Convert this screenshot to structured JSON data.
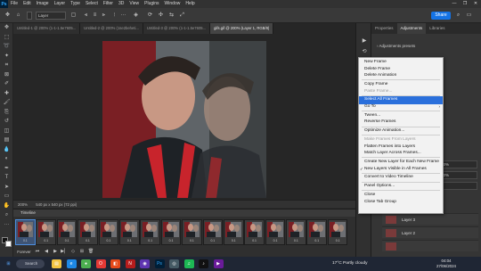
{
  "app": {
    "logo": "Ps"
  },
  "menu": [
    "File",
    "Edit",
    "Image",
    "Layer",
    "Type",
    "Select",
    "Filter",
    "3D",
    "View",
    "Plugins",
    "Window",
    "Help"
  ],
  "window_controls": [
    "—",
    "❐",
    "✕"
  ],
  "options_bar": {
    "layer_select": "Layer",
    "share_label": "Share",
    "icons": [
      "move-tool-icon",
      "auto-select-icon",
      "align-left-icon",
      "align-center-icon",
      "align-right-icon",
      "distribute-icon",
      "more-icon",
      "3d-mode-icon"
    ]
  },
  "tools": [
    "move-tool-icon",
    "marquee-tool-icon",
    "lasso-tool-icon",
    "magic-wand-icon",
    "crop-tool-icon",
    "frame-tool-icon",
    "eyedropper-icon",
    "healing-brush-icon",
    "brush-tool-icon",
    "clone-stamp-icon",
    "history-brush-icon",
    "eraser-icon",
    "gradient-icon",
    "blur-icon",
    "dodge-icon",
    "pen-tool-icon",
    "type-tool-icon",
    "path-select-icon",
    "rectangle-tool-icon",
    "hand-tool-icon",
    "zoom-tool-icon",
    "more-tools-icon"
  ],
  "tabs": [
    {
      "label": "Untitled-1 @ 200% (1-1-1.5e7605...",
      "active": false
    },
    {
      "label": "Untitled-2 @ 200% (1se2beheti...",
      "active": false
    },
    {
      "label": "Untitled-3 @ 200% (1-1-1.5e7605...",
      "active": false
    },
    {
      "label": "gifs.gif @ 200% (Layer 1, RGB/8)",
      "active": true
    }
  ],
  "status": {
    "zoom": "200%",
    "doc_info": "540 px x 540 px (72 ppi)"
  },
  "timeline": {
    "title": "Timeline",
    "frame_count": 16,
    "frame_time": "0.1",
    "loop_label": "Forever"
  },
  "panel": {
    "tabs": [
      "Properties",
      "Adjustments",
      "Libraries"
    ],
    "active_tab": "Adjustments",
    "adjustments_label": "Adjustments presets",
    "layers": [
      "Layer 3",
      "Layer 2"
    ],
    "fields": [
      "100%",
      "100%",
      "1"
    ]
  },
  "context_menu": [
    {
      "label": "New Frame",
      "type": "item"
    },
    {
      "label": "Delete Frame",
      "type": "item"
    },
    {
      "label": "Delete Animation",
      "type": "item"
    },
    {
      "type": "sep"
    },
    {
      "label": "Copy Frame",
      "type": "item"
    },
    {
      "label": "Paste Frame...",
      "type": "item",
      "disabled": true
    },
    {
      "type": "sep"
    },
    {
      "label": "Select All Frames",
      "type": "item",
      "highlight": true
    },
    {
      "label": "Go To",
      "type": "item",
      "submenu": true
    },
    {
      "type": "sep"
    },
    {
      "label": "Tween...",
      "type": "item"
    },
    {
      "label": "Reverse Frames",
      "type": "item"
    },
    {
      "type": "sep"
    },
    {
      "label": "Optimize Animation...",
      "type": "item"
    },
    {
      "type": "sep"
    },
    {
      "label": "Make Frames From Layers",
      "type": "item",
      "disabled": true
    },
    {
      "label": "Flatten Frames into Layers",
      "type": "item"
    },
    {
      "label": "Match Layer Across Frames...",
      "type": "item"
    },
    {
      "type": "sep"
    },
    {
      "label": "Create New Layer for Each New Frame",
      "type": "item"
    },
    {
      "label": "New Layers Visible in All Frames",
      "type": "item",
      "checked": true
    },
    {
      "type": "sep"
    },
    {
      "label": "Convert to Video Timeline",
      "type": "item"
    },
    {
      "type": "sep"
    },
    {
      "label": "Panel Options...",
      "type": "item"
    },
    {
      "type": "sep"
    },
    {
      "label": "Close",
      "type": "item"
    },
    {
      "label": "Close Tab Group",
      "type": "item"
    }
  ],
  "taskbar": {
    "search_placeholder": "Search",
    "apps": [
      "file-explorer-icon",
      "edge-icon",
      "chrome-icon",
      "opera-icon",
      "office-icon",
      "netflix-icon",
      "photos-icon",
      "photoshop-icon",
      "camera-icon",
      "spotify-icon",
      "tiktok-icon",
      "streaming-icon"
    ],
    "weather": "17°C  Partly cloudy",
    "time": "04:04",
    "date": "27/06/2024"
  }
}
